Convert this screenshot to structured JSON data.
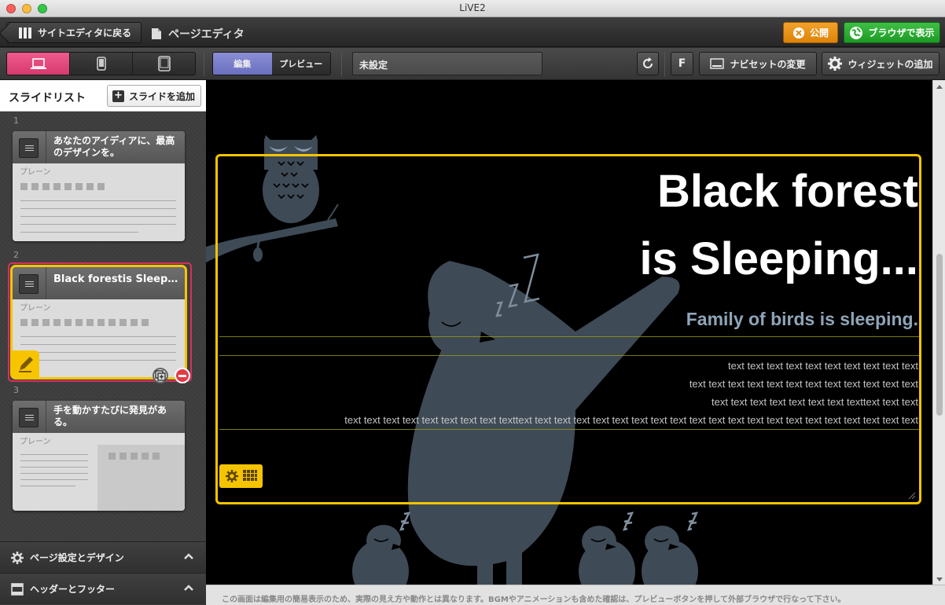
{
  "window": {
    "title": "LiVE2"
  },
  "toolbar": {
    "back_label": "サイトエディタに戻る",
    "page_title": "ページエディタ",
    "publish_label": "公開",
    "browser_label": "ブラウザで表示"
  },
  "modes": {
    "edit": "編集",
    "preview": "プレビュー",
    "active": "edit"
  },
  "devices": {
    "active": "desktop",
    "items": [
      "desktop",
      "smartphone",
      "tablet"
    ]
  },
  "page_name": "未設定",
  "toolbar_right": {
    "font_label": "F",
    "navset_label": "ナビセットの変更",
    "widget_label": "ウィジェットの追加"
  },
  "sidebar": {
    "title": "スライドリスト",
    "add_label": "スライドを追加",
    "slides": [
      {
        "number": "1",
        "title": "あなたのアイディアに、最高のデザインを。",
        "kind": "プレーン"
      },
      {
        "number": "2",
        "title": "Black forestis Sleep…",
        "kind": "プレーン",
        "selected": true
      },
      {
        "number": "3",
        "title": "手を動かすたびに発見がある。",
        "kind": "プレーン"
      }
    ],
    "sections": [
      {
        "label": "ページ設定とデザイン"
      },
      {
        "label": "ヘッダーとフッター"
      }
    ]
  },
  "slide": {
    "title_line1": "Black forest",
    "title_line2": "is Sleeping...",
    "subtitle": "Family of birds is sleeping.",
    "body_lines": [
      "text text text text text text text text text text",
      "text text text text text text text text text text text text",
      "text text text text text text text texttext text text",
      "text text text text text text text text texttext text text text text text text text text text text text text text text text text text text text text"
    ]
  },
  "colors": {
    "accent_pink": "#e04a7c",
    "highlight_yellow": "#f5c400",
    "publish_orange": "#e8911a",
    "browser_green": "#2aaa31",
    "preview_purple": "#7a7ec9",
    "illustration_slate": "#3e4a56"
  },
  "status": {
    "note": "この画面は編集用の簡易表示のため、実際の見え方や動作とは異なります。BGMやアニメーションも含めた確認は、プレビューボタンを押して外部ブラウザで行なって下さい。"
  }
}
